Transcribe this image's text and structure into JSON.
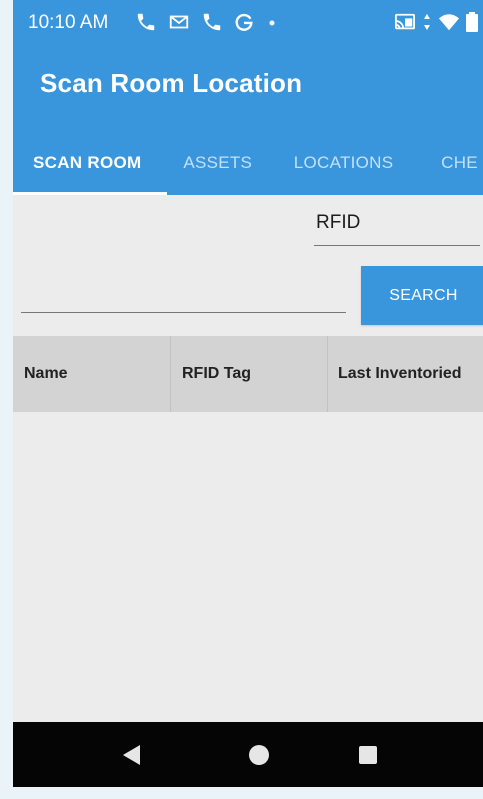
{
  "status_bar": {
    "time": "10:10 AM",
    "left_icons": [
      "phone-icon",
      "gmail-icon",
      "phone-icon",
      "google-icon",
      "dot-icon"
    ],
    "right_icons": [
      "cast-icon",
      "data-arrows-icon",
      "wifi-icon",
      "battery-icon"
    ]
  },
  "app_bar": {
    "title": "Scan Room Location",
    "color": "#3a96dc"
  },
  "tabs": [
    {
      "label": "SCAN ROOM",
      "active": true
    },
    {
      "label": "ASSETS",
      "active": false
    },
    {
      "label": "LOCATIONS",
      "active": false
    },
    {
      "label": "CHE",
      "active": false
    }
  ],
  "form": {
    "rfid_label": "RFID",
    "search_value": "",
    "search_button": "SEARCH"
  },
  "table": {
    "columns": [
      "Name",
      "RFID Tag",
      "Last Inventoried"
    ],
    "rows": []
  },
  "nav_bar": {
    "buttons": [
      "back-icon",
      "home-icon",
      "recents-icon"
    ]
  }
}
